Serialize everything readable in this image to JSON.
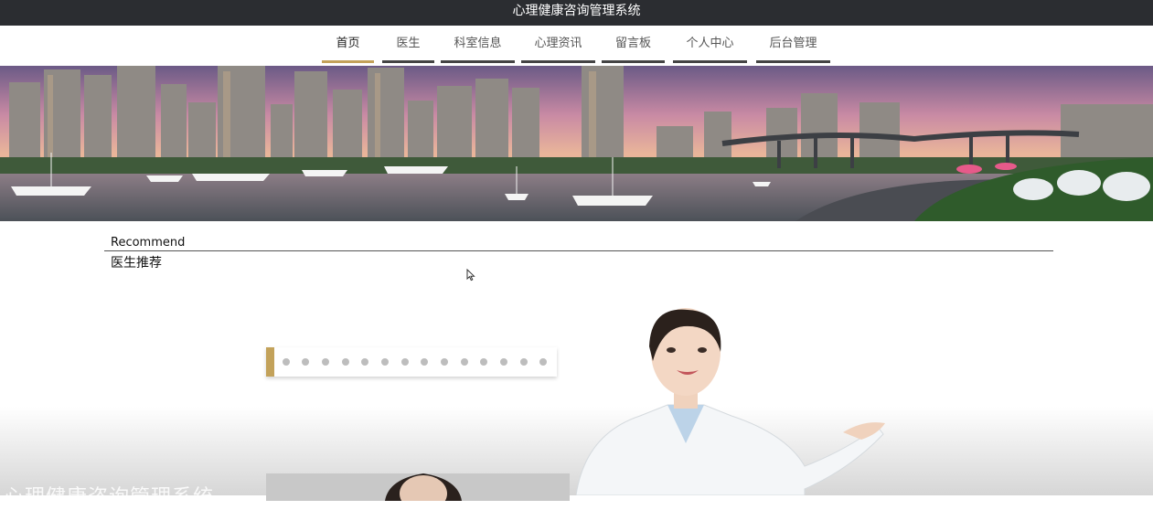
{
  "header": {
    "title": "心理健康咨询管理系统"
  },
  "nav": {
    "items": [
      {
        "label": "首页",
        "active": true
      },
      {
        "label": "医生"
      },
      {
        "label": "科室信息"
      },
      {
        "label": "心理资讯"
      },
      {
        "label": "留言板"
      },
      {
        "label": "个人中心"
      },
      {
        "label": "后台管理"
      }
    ]
  },
  "section": {
    "title_en": "Recommend",
    "title_cn": "医生推荐"
  },
  "carousel": {
    "page_count": 14,
    "current_page": 1
  },
  "watermark": "心理健康咨询管理系统",
  "colors": {
    "accent": "#c3a25a",
    "topbar": "#2b2d31",
    "nav_underline": "#444444"
  },
  "icons": {
    "cursor": "mouse-pointer-icon"
  }
}
